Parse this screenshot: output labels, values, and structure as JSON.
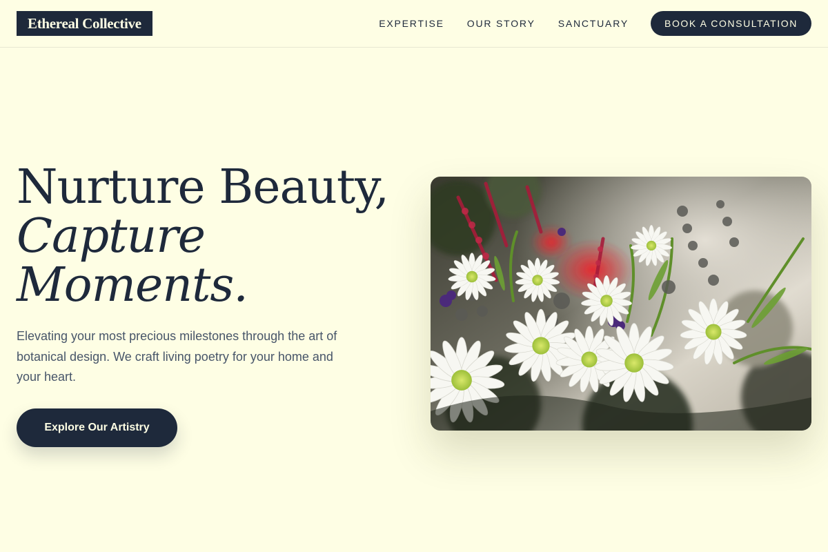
{
  "brand": {
    "name": "Ethereal Collective"
  },
  "nav": {
    "links": [
      "EXPERTISE",
      "OUR STORY",
      "SANCTUARY"
    ],
    "cta_label": "BOOK A CONSULTATION"
  },
  "hero": {
    "title_line1": "Nurture Beauty,",
    "title_line2": "Capture",
    "title_line3": "Moments.",
    "subtitle": "Elevating your most precious milestones through the art of botanical design. We craft living poetry for your home and your heart.",
    "button_label": "Explore Our Artistry",
    "image_icon": "flower-bouquet-photo"
  },
  "colors": {
    "background": "#fefee4",
    "primary": "#1e293b",
    "muted_text": "#475569"
  }
}
